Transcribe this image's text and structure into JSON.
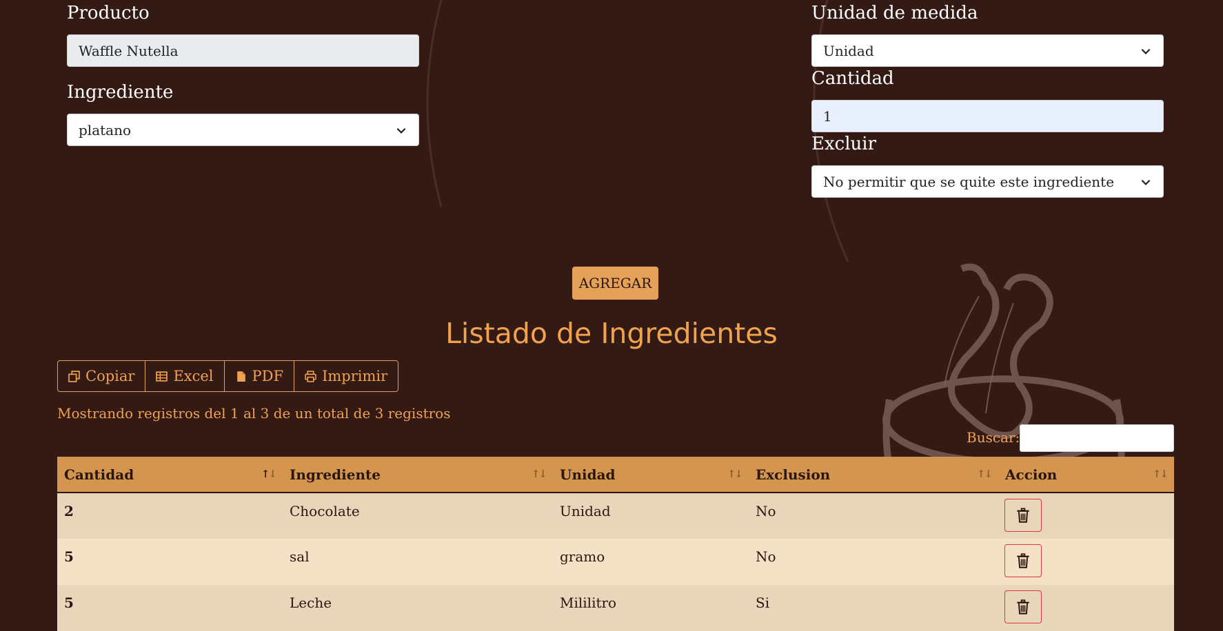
{
  "form": {
    "producto": {
      "label": "Producto",
      "value": "Waffle Nutella"
    },
    "ingrediente": {
      "label": "Ingrediente",
      "value": "platano"
    },
    "unidad": {
      "label": "Unidad de medida",
      "value": "Unidad"
    },
    "cantidad": {
      "label": "Cantidad",
      "value": "1"
    },
    "excluir": {
      "label": "Excluir",
      "value": "No permitir que se quite este ingrediente"
    },
    "add_button": "AGREGAR"
  },
  "list": {
    "title": "Listado de Ingredientes",
    "export_buttons": [
      {
        "label": "Copiar",
        "icon": "copy-icon"
      },
      {
        "label": "Excel",
        "icon": "table-icon"
      },
      {
        "label": "PDF",
        "icon": "pdf-file-icon"
      },
      {
        "label": "Imprimir",
        "icon": "printer-icon"
      }
    ],
    "info": "Mostrando registros del 1 al 3 de un total de 3 registros",
    "search_label": "Buscar:",
    "search_value": "",
    "columns": [
      "Cantidad",
      "Ingrediente",
      "Unidad",
      "Exclusion",
      "Accion"
    ],
    "rows": [
      {
        "cantidad": "2",
        "ingrediente": "Chocolate",
        "unidad": "Unidad",
        "exclusion": "No"
      },
      {
        "cantidad": "5",
        "ingrediente": "sal",
        "unidad": "gramo",
        "exclusion": "No"
      },
      {
        "cantidad": "5",
        "ingrediente": "Leche",
        "unidad": "Mililitro",
        "exclusion": "Si"
      }
    ]
  },
  "colors": {
    "background": "#331a14",
    "accent": "#f0a24f",
    "button": "#e6a158",
    "header": "#d4954f",
    "delete": "#dc3545"
  }
}
